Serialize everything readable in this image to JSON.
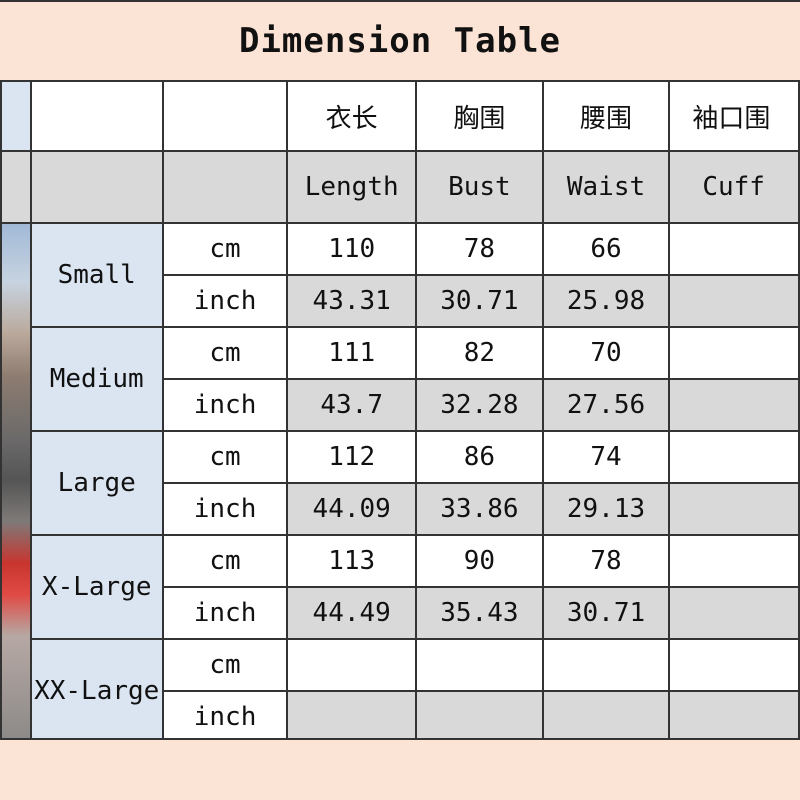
{
  "title": "Dimension Table",
  "headers_zh": [
    "衣长",
    "胸围",
    "腰围",
    "袖口围"
  ],
  "headers_en": [
    "Length",
    "Bust",
    "Waist",
    "Cuff"
  ],
  "units": {
    "cm": "cm",
    "inch": "inch"
  },
  "sizes": [
    {
      "name": "Small",
      "cm": [
        "110",
        "78",
        "66",
        ""
      ],
      "inch": [
        "43.31",
        "30.71",
        "25.98",
        ""
      ]
    },
    {
      "name": "Medium",
      "cm": [
        "111",
        "82",
        "70",
        ""
      ],
      "inch": [
        "43.7",
        "32.28",
        "27.56",
        ""
      ]
    },
    {
      "name": "Large",
      "cm": [
        "112",
        "86",
        "74",
        ""
      ],
      "inch": [
        "44.09",
        "33.86",
        "29.13",
        ""
      ]
    },
    {
      "name": "X-Large",
      "cm": [
        "113",
        "90",
        "78",
        ""
      ],
      "inch": [
        "44.49",
        "35.43",
        "30.71",
        ""
      ]
    },
    {
      "name": "XX-Large",
      "cm": [
        "",
        "",
        "",
        ""
      ],
      "inch": [
        "",
        "",
        "",
        ""
      ]
    }
  ]
}
